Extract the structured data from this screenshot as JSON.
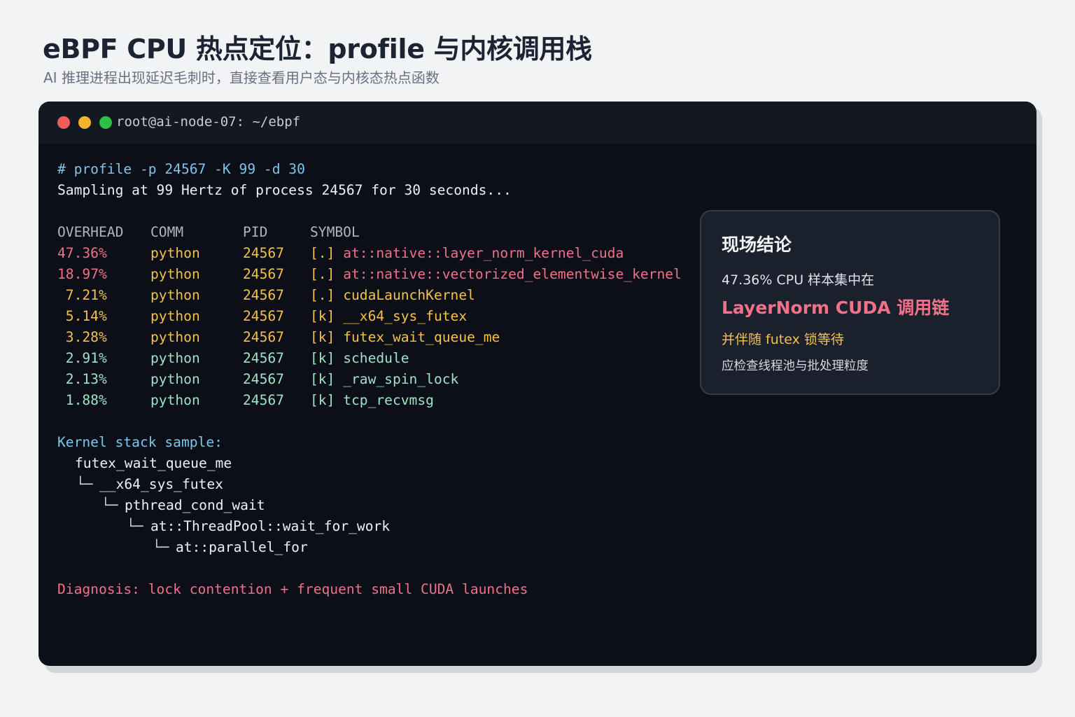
{
  "page": {
    "title": "eBPF CPU 热点定位：profile 与内核调用栈",
    "subtitle": "AI 推理进程出现延迟毛刺时，直接查看用户态与内核态热点函数"
  },
  "window": {
    "title": "root@ai-node-07: ~/ebpf"
  },
  "terminal": {
    "command": "# profile -p 24567 -K 99 -d 30",
    "sampling_line": "Sampling at 99 Hertz of process 24567 for 30 seconds...",
    "table": {
      "headers": [
        "OVERHEAD",
        "COMM",
        "PID",
        "SYMBOL"
      ],
      "rows": [
        {
          "overhead": "47.36%",
          "comm": "python",
          "pid": "24567",
          "tag": "[.]",
          "symbol": "at::native::layer_norm_kernel_cuda"
        },
        {
          "overhead": "18.97%",
          "comm": "python",
          "pid": "24567",
          "tag": "[.]",
          "symbol": "at::native::vectorized_elementwise_kernel"
        },
        {
          "overhead": " 7.21%",
          "comm": "python",
          "pid": "24567",
          "tag": "[.]",
          "symbol": "cudaLaunchKernel"
        },
        {
          "overhead": " 5.14%",
          "comm": "python",
          "pid": "24567",
          "tag": "[k]",
          "symbol": "__x64_sys_futex"
        },
        {
          "overhead": " 3.28%",
          "comm": "python",
          "pid": "24567",
          "tag": "[k]",
          "symbol": "futex_wait_queue_me"
        },
        {
          "overhead": " 2.91%",
          "comm": "python",
          "pid": "24567",
          "tag": "[k]",
          "symbol": "schedule"
        },
        {
          "overhead": " 2.13%",
          "comm": "python",
          "pid": "24567",
          "tag": "[k]",
          "symbol": "_raw_spin_lock"
        },
        {
          "overhead": " 1.88%",
          "comm": "python",
          "pid": "24567",
          "tag": "[k]",
          "symbol": "tcp_recvmsg"
        }
      ]
    },
    "stack": {
      "heading": "Kernel stack sample:",
      "frames": [
        {
          "glyph": "",
          "name": "futex_wait_queue_me"
        },
        {
          "glyph": "└─",
          "name": "__x64_sys_futex"
        },
        {
          "glyph": "└─",
          "name": "pthread_cond_wait"
        },
        {
          "glyph": "└─",
          "name": "at::ThreadPool::wait_for_work"
        },
        {
          "glyph": "└─",
          "name": "at::parallel_for"
        }
      ]
    },
    "diagnosis": "Diagnosis: lock contention + frequent small CUDA launches"
  },
  "card": {
    "title": "现场结论",
    "line1": "47.36% CPU 样本集中在",
    "highlight": "LayerNorm CUDA 调用链",
    "line3": "并伴随 futex 锁等待",
    "line4": "应检查线程池与批处理粒度"
  },
  "colors": {
    "background": "#f2f3f5",
    "terminal_bg": "#0c0f17",
    "titlebar_bg": "#141820",
    "blue": "#7cc6ec",
    "red": "#f07189",
    "yellow": "#f4c14a",
    "green": "#9fe2c6",
    "traffic_red": "#ef5b57",
    "traffic_yellow": "#f2b42b",
    "traffic_green": "#2bc046"
  }
}
